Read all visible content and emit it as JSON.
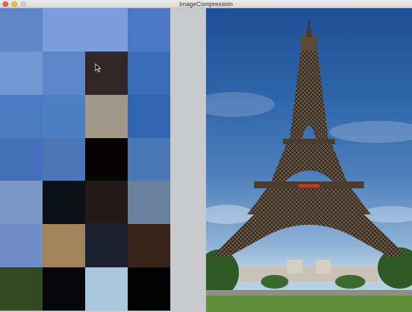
{
  "window": {
    "title": "ImageCompression"
  },
  "mosaic": {
    "tiles": [
      {
        "r": 0,
        "c": 0,
        "color": "#5e86c7"
      },
      {
        "r": 0,
        "c": 1,
        "color": "#7a9edb"
      },
      {
        "r": 0,
        "c": 2,
        "color": "#7a9edb"
      },
      {
        "r": 0,
        "c": 3,
        "color": "#4a78c4"
      },
      {
        "r": 1,
        "c": 0,
        "color": "#7199d4"
      },
      {
        "r": 1,
        "c": 1,
        "color": "#5b86c8"
      },
      {
        "r": 1,
        "c": 2,
        "color": "#2f2826"
      },
      {
        "r": 1,
        "c": 3,
        "color": "#3a6db8"
      },
      {
        "r": 2,
        "c": 0,
        "color": "#4c7cc3"
      },
      {
        "r": 2,
        "c": 1,
        "color": "#4c7fc6"
      },
      {
        "r": 2,
        "c": 2,
        "color": "#a29887"
      },
      {
        "r": 2,
        "c": 3,
        "color": "#3265b1"
      },
      {
        "r": 3,
        "c": 0,
        "color": "#4471ba"
      },
      {
        "r": 3,
        "c": 1,
        "color": "#4b77b6"
      },
      {
        "r": 3,
        "c": 2,
        "color": "#050304"
      },
      {
        "r": 3,
        "c": 3,
        "color": "#4a78b6"
      },
      {
        "r": 4,
        "c": 0,
        "color": "#7c98c7"
      },
      {
        "r": 4,
        "c": 1,
        "color": "#0c1116"
      },
      {
        "r": 4,
        "c": 2,
        "color": "#231b1a"
      },
      {
        "r": 4,
        "c": 3,
        "color": "#697f9b"
      },
      {
        "r": 5,
        "c": 0,
        "color": "#6f8dc4"
      },
      {
        "r": 5,
        "c": 1,
        "color": "#a3835a"
      },
      {
        "r": 5,
        "c": 2,
        "color": "#1d2230"
      },
      {
        "r": 5,
        "c": 3,
        "color": "#3a2419"
      },
      {
        "r": 6,
        "c": 0,
        "color": "#324a22"
      },
      {
        "r": 6,
        "c": 1,
        "color": "#07060a"
      },
      {
        "r": 6,
        "c": 2,
        "color": "#a9c6de"
      },
      {
        "r": 6,
        "c": 3,
        "color": "#030203"
      }
    ]
  },
  "photo": {
    "subject": "eiffel-tower"
  }
}
